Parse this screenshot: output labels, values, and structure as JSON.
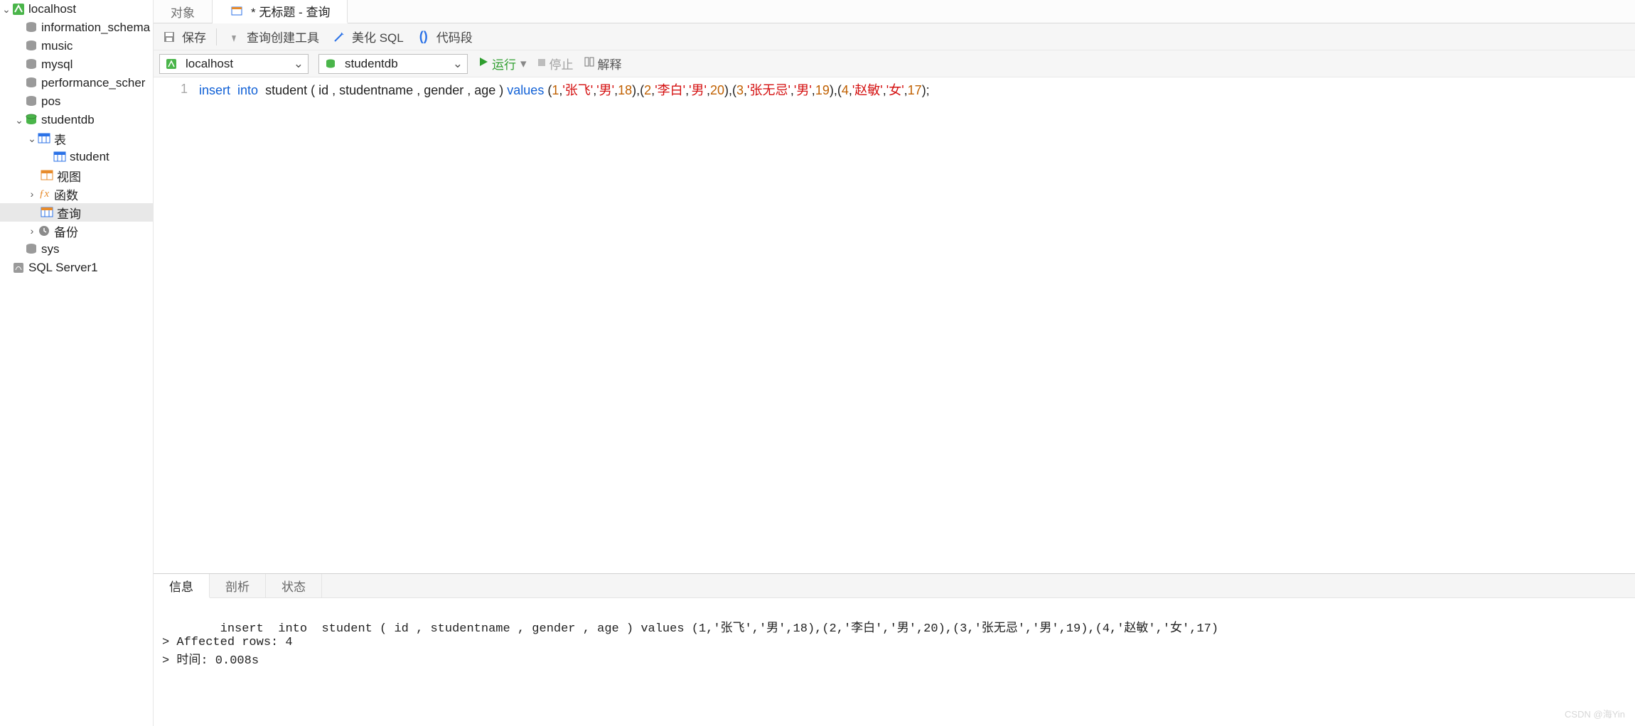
{
  "sidebar": {
    "connection": "localhost",
    "dbs": [
      "information_schema",
      "music",
      "mysql",
      "performance_scher",
      "pos"
    ],
    "current_db": "studentdb",
    "folders": {
      "tables": "表",
      "table_item": "student",
      "views": "视图",
      "functions": "函数",
      "queries": "查询",
      "backups": "备份"
    },
    "after_dbs": [
      "sys"
    ],
    "other_conn": "SQL Server1"
  },
  "tabs": {
    "object": "对象",
    "query": "* 无标题 - 查询"
  },
  "toolbar": {
    "save": "保存",
    "builder": "查询创建工具",
    "beautify": "美化 SQL",
    "snippet": "代码段"
  },
  "conn": {
    "connection": "localhost",
    "database": "studentdb",
    "run": "运行",
    "stop": "停止",
    "explain": "解释"
  },
  "editor": {
    "line_no": "1",
    "tokens": [
      {
        "t": "insert",
        "c": "kw"
      },
      {
        "t": "  "
      },
      {
        "t": "into",
        "c": "kw"
      },
      {
        "t": "  student ( id , studentname , gender , age ) "
      },
      {
        "t": "values",
        "c": "kw"
      },
      {
        "t": " ("
      },
      {
        "t": "1",
        "c": "num"
      },
      {
        "t": ","
      },
      {
        "t": "'张飞'",
        "c": "str"
      },
      {
        "t": ","
      },
      {
        "t": "'男'",
        "c": "str"
      },
      {
        "t": ","
      },
      {
        "t": "18",
        "c": "num"
      },
      {
        "t": "),("
      },
      {
        "t": "2",
        "c": "num"
      },
      {
        "t": ","
      },
      {
        "t": "'李白'",
        "c": "str"
      },
      {
        "t": ","
      },
      {
        "t": "'男'",
        "c": "str"
      },
      {
        "t": ","
      },
      {
        "t": "20",
        "c": "num"
      },
      {
        "t": "),("
      },
      {
        "t": "3",
        "c": "num"
      },
      {
        "t": ","
      },
      {
        "t": "'张无忌'",
        "c": "str"
      },
      {
        "t": ","
      },
      {
        "t": "'男'",
        "c": "str"
      },
      {
        "t": ","
      },
      {
        "t": "19",
        "c": "num"
      },
      {
        "t": "),("
      },
      {
        "t": "4",
        "c": "num"
      },
      {
        "t": ","
      },
      {
        "t": "'赵敏'",
        "c": "str"
      },
      {
        "t": ","
      },
      {
        "t": "'女'",
        "c": "str"
      },
      {
        "t": ","
      },
      {
        "t": "17",
        "c": "num"
      },
      {
        "t": ");"
      }
    ]
  },
  "bottom": {
    "tabs": {
      "info": "信息",
      "profile": "剖析",
      "status": "状态"
    },
    "lines": [
      "insert  into  student ( id , studentname , gender , age ) values (1,'张飞','男',18),(2,'李白','男',20),(3,'张无忌','男',19),(4,'赵敏','女',17)",
      "> Affected rows: 4",
      "> 时间: 0.008s"
    ],
    "watermark": "CSDN @海Yin"
  }
}
